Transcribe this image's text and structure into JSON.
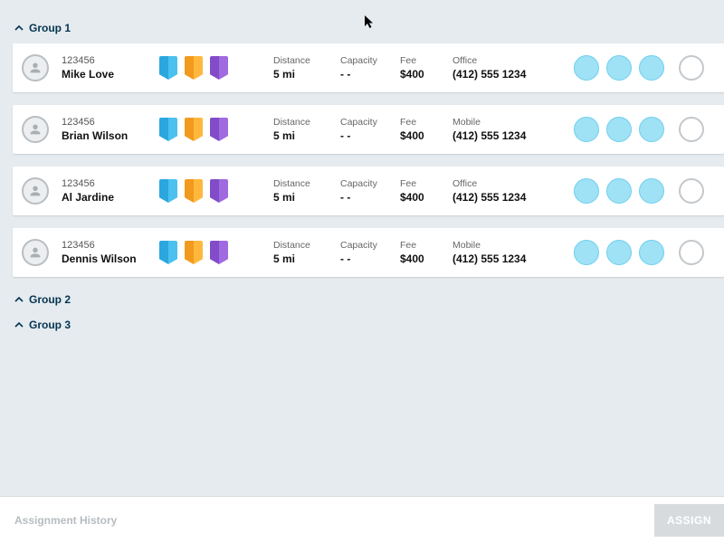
{
  "groups": [
    {
      "label": "Group 1",
      "expanded": true
    },
    {
      "label": "Group 2",
      "expanded": false
    },
    {
      "label": "Group 3",
      "expanded": false
    }
  ],
  "columns": {
    "distance": "Distance",
    "capacity": "Capacity",
    "fee": "Fee"
  },
  "people": [
    {
      "id": "123456",
      "name": "Mike Love",
      "distance": "5 mi",
      "capacity": "- -",
      "fee": "$400",
      "contact_type": "Office",
      "contact_value": "(412) 555 1234"
    },
    {
      "id": "123456",
      "name": "Brian Wilson",
      "distance": "5 mi",
      "capacity": "- -",
      "fee": "$400",
      "contact_type": "Mobile",
      "contact_value": "(412) 555 1234"
    },
    {
      "id": "123456",
      "name": "Al Jardine",
      "distance": "5 mi",
      "capacity": "- -",
      "fee": "$400",
      "contact_type": "Office",
      "contact_value": "(412) 555 1234"
    },
    {
      "id": "123456",
      "name": "Dennis Wilson",
      "distance": "5 mi",
      "capacity": "- -",
      "fee": "$400",
      "contact_type": "Mobile",
      "contact_value": "(412) 555 1234"
    }
  ],
  "footer": {
    "history_label": "Assignment History",
    "assign_label": "ASSIGN"
  },
  "badge_colors": [
    "#2aa7df",
    "#f19a1e",
    "#824cc8"
  ],
  "action_color": "#9fe1f5"
}
